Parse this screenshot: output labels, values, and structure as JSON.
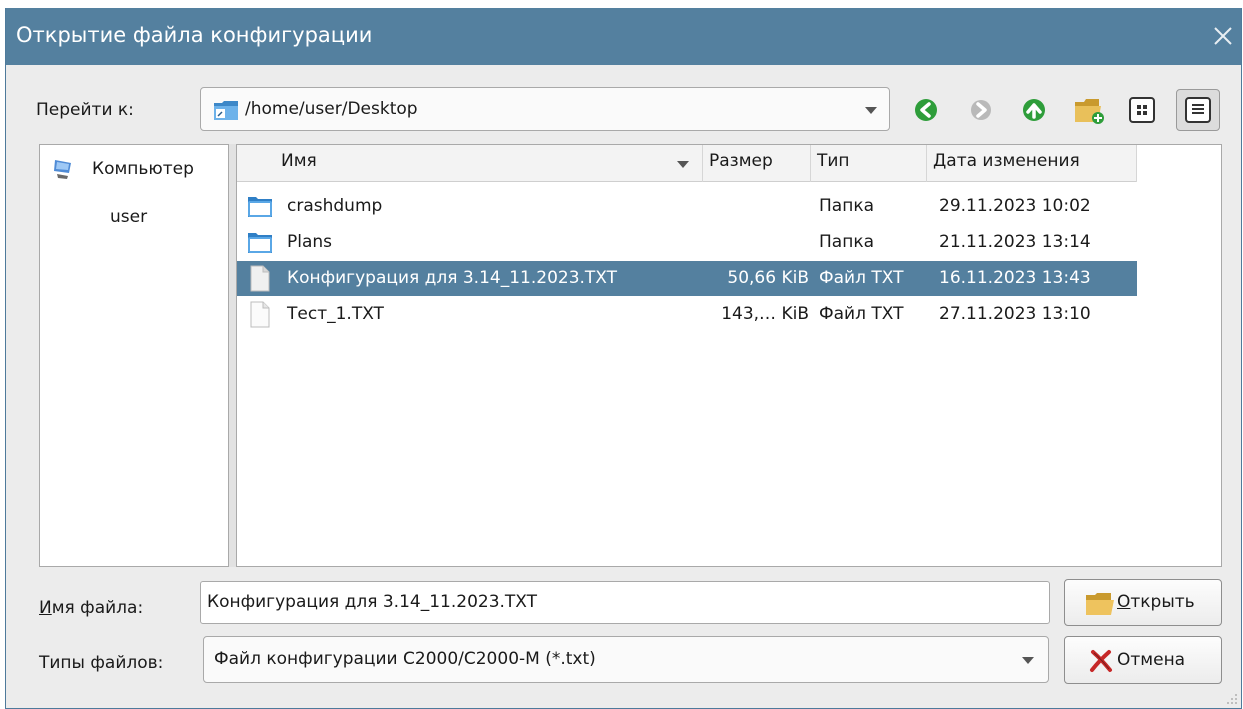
{
  "window": {
    "title": "Открытие файла конфигурации",
    "close_icon": "close-icon"
  },
  "goto": {
    "label": "Перейти к:",
    "path": "/home/user/Desktop"
  },
  "toolbar": {
    "back_icon": "back-arrow-icon",
    "forward_icon": "forward-arrow-icon",
    "up_icon": "up-arrow-icon",
    "new_folder_icon": "new-folder-icon",
    "icon_view_icon": "icon-view-icon",
    "detail_view_icon": "detail-view-icon"
  },
  "sidebar": {
    "items": [
      {
        "label": "Компьютер",
        "icon": "computer-icon"
      },
      {
        "label": "user"
      }
    ]
  },
  "files": {
    "columns": [
      "Имя",
      "Размер",
      "Тип",
      "Дата изменения"
    ],
    "rows": [
      {
        "name": "crashdump",
        "size": "",
        "type": "Папка",
        "date": "29.11.2023 10:02",
        "icon": "folder-icon"
      },
      {
        "name": "Plans",
        "size": "",
        "type": "Папка",
        "date": "21.11.2023 13:14",
        "icon": "folder-icon"
      },
      {
        "name": "Конфигурация для 3.14_11.2023.TXT",
        "size": "50,66 KiB",
        "type": "Файл TXT",
        "date": "16.11.2023 13:43",
        "icon": "file-icon",
        "selected": true
      },
      {
        "name": "Тест_1.TXT",
        "size": "143,… KiB",
        "type": "Файл TXT",
        "date": "27.11.2023 13:10",
        "icon": "file-icon"
      }
    ]
  },
  "filename": {
    "label_first": "И",
    "label_rest": "мя файла:",
    "value": "Конфигурация для 3.14_11.2023.TXT"
  },
  "filetype": {
    "label": "Типы файлов:",
    "value": "Файл конфигурации С2000/С2000-М (*.txt)"
  },
  "buttons": {
    "open_first": "О",
    "open_rest": "ткрыть",
    "cancel": "Отмена"
  },
  "colors": {
    "titlebar": "#54809f",
    "selection": "#54809f",
    "icon_green": "#2e9d3a"
  }
}
